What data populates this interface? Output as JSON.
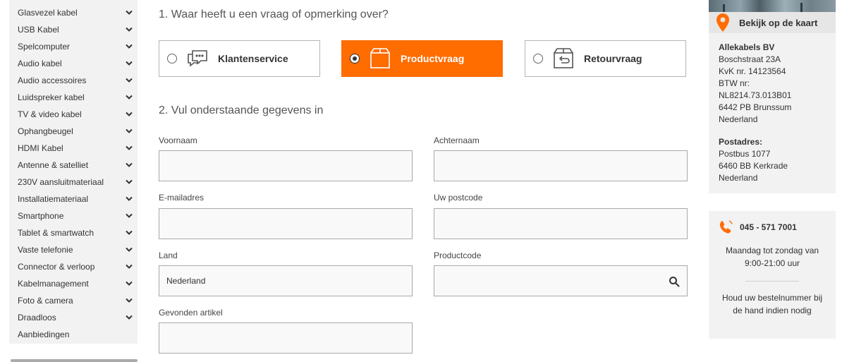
{
  "sidebar": {
    "items": [
      {
        "label": "Glasvezel kabel",
        "has_submenu": true
      },
      {
        "label": "USB Kabel",
        "has_submenu": true
      },
      {
        "label": "Spelcomputer",
        "has_submenu": true
      },
      {
        "label": "Audio kabel",
        "has_submenu": true
      },
      {
        "label": "Audio accessoires",
        "has_submenu": true
      },
      {
        "label": "Luidspreker kabel",
        "has_submenu": true
      },
      {
        "label": "TV & video kabel",
        "has_submenu": true
      },
      {
        "label": "Ophangbeugel",
        "has_submenu": true
      },
      {
        "label": "HDMI Kabel",
        "has_submenu": true
      },
      {
        "label": "Antenne & satelliet",
        "has_submenu": true
      },
      {
        "label": "230V aansluitmateriaal",
        "has_submenu": true
      },
      {
        "label": "Installatiemateriaal",
        "has_submenu": true
      },
      {
        "label": "Smartphone",
        "has_submenu": true
      },
      {
        "label": "Tablet & smartwatch",
        "has_submenu": true
      },
      {
        "label": "Vaste telefonie",
        "has_submenu": true
      },
      {
        "label": "Connector & verloop",
        "has_submenu": true
      },
      {
        "label": "Kabelmanagement",
        "has_submenu": true
      },
      {
        "label": "Foto & camera",
        "has_submenu": true
      },
      {
        "label": "Draadloos",
        "has_submenu": true
      },
      {
        "label": "Aanbiedingen",
        "has_submenu": false
      }
    ]
  },
  "form": {
    "step1_title": "1. Waar heeft u een vraag of opmerking over?",
    "options": [
      {
        "label": "Klantenservice",
        "icon": "chat-bubbles-icon",
        "selected": false
      },
      {
        "label": "Productvraag",
        "icon": "box-icon",
        "selected": true
      },
      {
        "label": "Retourvraag",
        "icon": "return-box-icon",
        "selected": false
      }
    ],
    "step2_title": "2. Vul onderstaande gegevens in",
    "fields": {
      "voornaam": {
        "label": "Voornaam",
        "value": ""
      },
      "achternaam": {
        "label": "Achternaam",
        "value": ""
      },
      "email": {
        "label": "E-mailadres",
        "value": ""
      },
      "postcode": {
        "label": "Uw postcode",
        "value": ""
      },
      "land": {
        "label": "Land",
        "value": "Nederland"
      },
      "productcode": {
        "label": "Productcode",
        "value": ""
      },
      "artikel": {
        "label": "Gevonden artikel",
        "value": ""
      }
    }
  },
  "right": {
    "map_button": "Bekijk op de kaart",
    "address": {
      "company": "Allekabels BV",
      "street": "Boschstraat 23A",
      "kvk": "KvK nr. 14123564",
      "btw_label": "BTW nr:",
      "btw": "NL8214.73.013B01",
      "city": "6442 PB Brunssum",
      "country": "Nederland",
      "postal_heading": "Postadres:",
      "postbus": "Postbus 1077",
      "postal_city": "6460 BB Kerkrade",
      "postal_country": "Nederland"
    },
    "contact": {
      "phone": "045 - 571 7001",
      "hours_line1": "Maandag tot zondag van",
      "hours_line2": "9:00-21:00 uur",
      "note_line1": "Houd uw bestelnummer bij",
      "note_line2": "de hand indien nodig"
    }
  },
  "colors": {
    "accent": "#ff6c00",
    "panel_bg": "#f2f2f2",
    "field_border": "#a9a9a9"
  }
}
